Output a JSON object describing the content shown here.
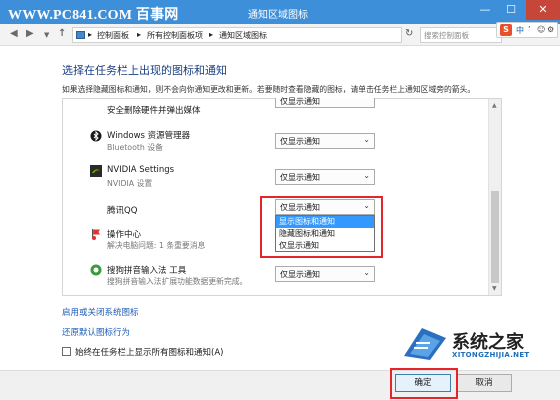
{
  "watermark": {
    "site": "WWW.PC841.COM 百事网"
  },
  "window": {
    "title": "通知区域图标",
    "min": "—",
    "max": "☐",
    "close": "✕"
  },
  "nav": {
    "back": "◀",
    "forward": "▶",
    "dropdown": "▼",
    "up": "↑",
    "refresh": "↻"
  },
  "breadcrumb": [
    "控制面板",
    "所有控制面板项",
    "通知区域图标"
  ],
  "breadcrumb_sep": "▸",
  "search": {
    "placeholder": "搜索控制面板"
  },
  "ime": {
    "logo": "S",
    "mode": "中",
    "symbols": [
      "’",
      "☺",
      "⚙"
    ]
  },
  "heading": "选择在任务栏上出现的图标和通知",
  "description": "如果选择隐藏图标和通知，则不会向你通知更改和更新。若要随时查看隐藏的图标，请单击任务栏上通知区域旁的箭头。",
  "items": [
    {
      "name": "安全删除硬件并弹出媒体",
      "value": "仅显示通知"
    },
    {
      "name": "Windows 资源管理器",
      "sub": "Bluetooth 设备",
      "value": "仅显示通知",
      "icon": "bluetooth-icon"
    },
    {
      "name": "NVIDIA Settings",
      "sub": "NVIDIA 设置",
      "value": "仅显示通知",
      "icon": "nvidia-icon"
    },
    {
      "name": "腾讯QQ",
      "value": "仅显示通知"
    },
    {
      "name": "操作中心",
      "sub": "解决电脑问题: 1 条重要消息",
      "icon": "action-center-flag-icon"
    },
    {
      "name": "搜狗拼音输入法 工具",
      "sub": "搜狗拼音输入法扩展功能数据更新完成。",
      "value": "仅显示通知",
      "icon": "sogou-icon"
    }
  ],
  "dropdown_options": [
    "显示图标和通知",
    "隐藏图标和通知",
    "仅显示通知"
  ],
  "links": {
    "system_icons": "启用或关闭系统图标",
    "restore": "还原默认图标行为"
  },
  "always_show": "始终在任务栏上显示所有图标和通知(A)",
  "buttons": {
    "ok": "确定",
    "cancel": "取消"
  },
  "logo": {
    "text": "系统之家",
    "url": "XITONGZHIJIA.NET"
  },
  "colors": {
    "titlebar": "#3d8fd9",
    "accent_link": "#1b5cb8",
    "highlight": "#e3262b",
    "selected_option": "#3399ff"
  }
}
